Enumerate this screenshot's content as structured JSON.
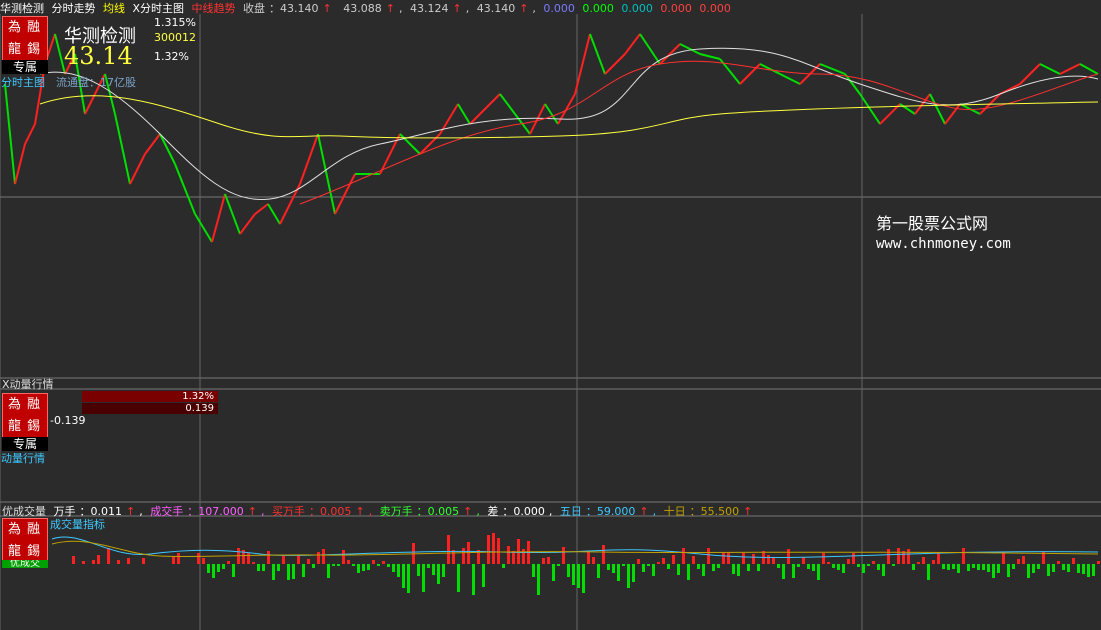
{
  "topbar": {
    "title": "华测检测",
    "tab_intraday": "分时走势",
    "avg_label": "均线",
    "x_main": "X分时主图",
    "red_label": "中线趋势",
    "close_label": "收盘",
    "close_value": "43.140",
    "v1": "43.088",
    "v2": "43.124",
    "v3": "43.140",
    "z1": "0.000",
    "z2": "0.000",
    "z3": "0.000",
    "z4": "0.000",
    "z5": "0.000",
    "up_arrow": "↑"
  },
  "badge": {
    "r1": "為融",
    "r2": "龍錫",
    "zs": "专属"
  },
  "main": {
    "stock_name": "华测检测",
    "price": "43.14",
    "pct1": "1.315%",
    "code": "300012",
    "pct2": "1.32%",
    "left_label": "分时主图",
    "flow_label": "流通盘：17亿股",
    "watermark1": "第一股票公式网",
    "watermark2": "www.chnmoney.com"
  },
  "momentum": {
    "title": "X动量行情",
    "bar1": "1.32%",
    "bar2": "0.139",
    "value": "-0.139",
    "left_label": "动量行情"
  },
  "volume": {
    "title": "优成交量",
    "wanshou_label": "万手",
    "wanshou_val": "0.011",
    "cjs_label": "成交手",
    "cjs_val": "107.000",
    "buy_label": "买万手",
    "buy_val": "0.005",
    "sell_label": "卖万手",
    "sell_val": "0.005",
    "diff_label": "差",
    "diff_val": "0.000",
    "d5_label": "五日",
    "d5_val": "59.000",
    "d10_label": "十日",
    "d10_val": "55.500",
    "indicator_label": "成交量指标",
    "left_label": "优成交"
  },
  "colors": {
    "bg": "#2b2b2b",
    "red": "#ff2020",
    "green": "#00e000",
    "yellow": "#ffff40",
    "white": "#e0e0e0",
    "cyan": "#3ec8ff",
    "grid": "#555555"
  }
}
